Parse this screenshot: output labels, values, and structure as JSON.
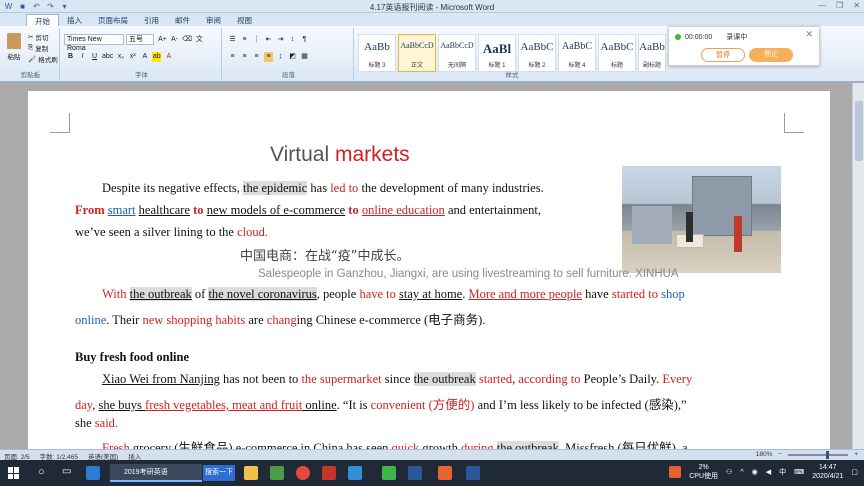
{
  "window": {
    "title": "4.17英语报刊阅读 - Microsoft Word"
  },
  "tabs": [
    "开始",
    "插入",
    "页面布局",
    "引用",
    "邮件",
    "审阅",
    "视图"
  ],
  "ribbon": {
    "clipboard": {
      "paste": "粘贴",
      "cut": "剪切",
      "copy": "复制",
      "format_painter": "格式刷",
      "group": "剪贴板"
    },
    "font": {
      "name": "Times New Roma",
      "size": "五号",
      "group": "字体"
    },
    "paragraph": {
      "group": "段落"
    },
    "styles": {
      "group": "样式",
      "items": [
        {
          "sample": "AaBb",
          "name": "标题 3"
        },
        {
          "sample": "AaBbCcD",
          "name": "正文"
        },
        {
          "sample": "AaBbCcD",
          "name": "无间隔"
        },
        {
          "sample": "AaBl",
          "name": "标题 1"
        },
        {
          "sample": "AaBbC",
          "name": "标题 2"
        },
        {
          "sample": "AaBbC",
          "name": "标题 4"
        },
        {
          "sample": "AaBbC",
          "name": "标题"
        },
        {
          "sample": "AaBb",
          "name": "副标题"
        }
      ]
    }
  },
  "recorder": {
    "time": "00:00:00",
    "status": "录课中",
    "pause": "暂停",
    "stop": "停止"
  },
  "document": {
    "title_a": "Virtual ",
    "title_b": "markets",
    "p1_line1_a": "Despite its negative effects, ",
    "p1_line1_b": "the epidemic",
    "p1_line1_c": " has ",
    "p1_line1_d": "led to",
    "p1_line1_e": " the development of many industries.",
    "p1_line2_from": "From",
    "p1_line2_smart": "smart",
    "p1_line2_health": "healthcare",
    "p1_line2_to1": "to",
    "p1_line2_new": "new models of e-commerce",
    "p1_line2_to2": "to",
    "p1_line2_online": "online education",
    "p1_line2_end": " and entertainment,",
    "p1_line3_a": "we’ve seen a silver lining to the ",
    "p1_line3_cloud": "cloud.",
    "cn_heading": "中国电商：在战“疫”中成长。",
    "caption": "Salespeople in Ganzhou, Jiangxi, are using livestreaming to sell furniture. XINHUA",
    "p2_line1_with": "With",
    "p2_line1_outbreak": "the outbreak",
    "p2_line1_of": " of ",
    "p2_line1_novel": "the novel coronavirus",
    "p2_line1_people": ", people ",
    "p2_line1_haveto": "have to",
    "p2_line1_stay": "stay at home",
    "p2_line1_more": "More and more people",
    "p2_line1_have": " have ",
    "p2_line1_started": "started to",
    "p2_line1_shop": "shop",
    "p2_line2_online": "online",
    "p2_line2_a": ". Their ",
    "p2_line2_habits": "new shopping habits",
    "p2_line2_b": " are ",
    "p2_line2_chang": "chang",
    "p2_line2_c": "ing Chinese e-commerce (电子商务).",
    "h_buy": "Buy fresh food online",
    "p3_line1_xiao": "Xiao Wei from Nanjing",
    "p3_line1_a": " has not been to ",
    "p3_line1_super": "the supermarket",
    "p3_line1_since": " since ",
    "p3_line1_outbreak": "the outbreak",
    "p3_line1_started": "started",
    "p3_line1_acc": "according to",
    "p3_line1_people": " People’s Daily. ",
    "p3_line1_every": "Every",
    "p3_line2_day": "day",
    "p3_line2_she": "she buys ",
    "p3_line2_fresh": "fresh vegetables, meat and fruit",
    "p3_line2_online": " online",
    "p3_line2_quote": ".  “It is ",
    "p3_line2_conv": "convenient (方便的)",
    "p3_line2_rest": " and I’m less likely to be infected (感染),”",
    "p3_line3_she": "she ",
    "p3_line3_said": "said.",
    "p4_fresh": "Fresh",
    "p4_a": " grocery (生鲜食品) e-commerce in China has seen ",
    "p4_quick": "quick",
    "p4_b": " growth ",
    "p4_during": "during",
    "p4_outbreak": "the outbreak",
    "p4_c": ".   Missfresh (每日优鲜), a"
  },
  "statusbar": {
    "page": "页面: 2/5",
    "words": "字数: 1/2,465",
    "lang": "英语(美国)",
    "mode": "插入",
    "zoom": "180%"
  },
  "taskbar": {
    "word_task": "2019考研英语",
    "search_btn": "搜索一下",
    "cpu_pct": "2%",
    "cpu_label": "CPU使用",
    "ime": "中",
    "time": "14:47",
    "date": "2020/4/21"
  },
  "colors": {
    "accent_red": "#d21f1f",
    "accent_blue": "#1f5fb4",
    "ribbon": "#dbe7f5",
    "taskbar": "#1f2a36"
  }
}
